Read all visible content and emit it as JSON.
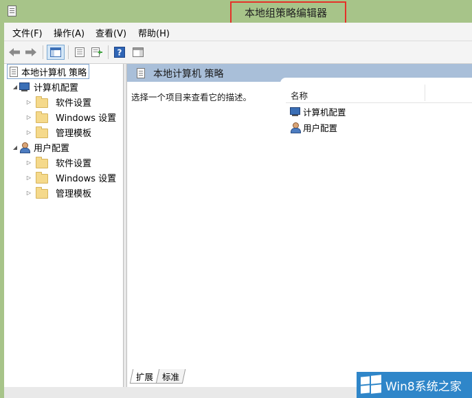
{
  "window": {
    "title": "本地组策略编辑器"
  },
  "menu": {
    "items": [
      {
        "label": "文件(F)"
      },
      {
        "label": "操作(A)"
      },
      {
        "label": "查看(V)"
      },
      {
        "label": "帮助(H)"
      }
    ]
  },
  "toolbar": {
    "buttons": [
      "back-icon",
      "forward-icon",
      "show-hide-tree-icon",
      "properties-icon",
      "export-list-icon",
      "help-icon",
      "show-hide-action-pane-icon"
    ]
  },
  "tree": {
    "root": "本地计算机 策略",
    "computer_config": "计算机配置",
    "user_config": "用户配置",
    "computer_children": [
      "软件设置",
      "Windows 设置",
      "管理模板"
    ],
    "user_children": [
      "软件设置",
      "Windows 设置",
      "管理模板"
    ]
  },
  "right_pane": {
    "header": "本地计算机 策略",
    "description": "选择一个项目来查看它的描述。",
    "column_name": "名称",
    "items": [
      "计算机配置",
      "用户配置"
    ]
  },
  "tabs": {
    "extended": "扩展",
    "standard": "标准",
    "selected": "扩展"
  },
  "watermark": {
    "text": "Win8系统之家"
  },
  "colors": {
    "title_bar": "#a7c489",
    "highlight": "#e53028",
    "pane_header": "#a9bfd9",
    "watermark_bg": "#2f86c9"
  }
}
